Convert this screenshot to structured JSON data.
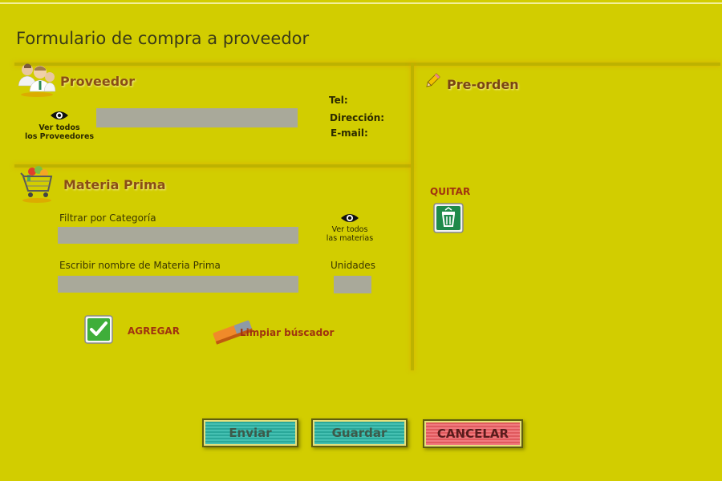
{
  "page": {
    "title": "Formulario de compra a proveedor"
  },
  "proveedor": {
    "heading": "Proveedor",
    "view_all_line1": "Ver todos",
    "view_all_line2": "los Proveedores",
    "tel_label": "Tel:",
    "direccion_label": "Dirección:",
    "email_label": "E-mail:"
  },
  "materia": {
    "heading": "Materia Prima",
    "filter_label": "Filtrar por Categoría",
    "view_all_line1": "Ver todos",
    "view_all_line2": "las materias",
    "name_label": "Escribir nombre de  Materia Prima",
    "units_label": "Unidades",
    "agregar": "AGREGAR",
    "limpiar": "Limpiar búscador"
  },
  "preorden": {
    "heading": "Pre-orden",
    "quitar": "QUITAR"
  },
  "buttons": {
    "enviar": "Enviar",
    "guardar": "Guardar",
    "cancelar": "CANCELAR"
  },
  "colors": {
    "background": "#d2cd00",
    "heading": "#8a4d14",
    "teal_button": "#2aa89a",
    "red_button": "#e05a5e"
  },
  "icons": {
    "proveedor": "users-icon",
    "materia": "shopping-cart-icon",
    "preorden": "pencil-icon",
    "view": "eye-icon",
    "agregar": "checkmark-icon",
    "limpiar": "eraser-icon",
    "quitar": "trash-icon"
  }
}
